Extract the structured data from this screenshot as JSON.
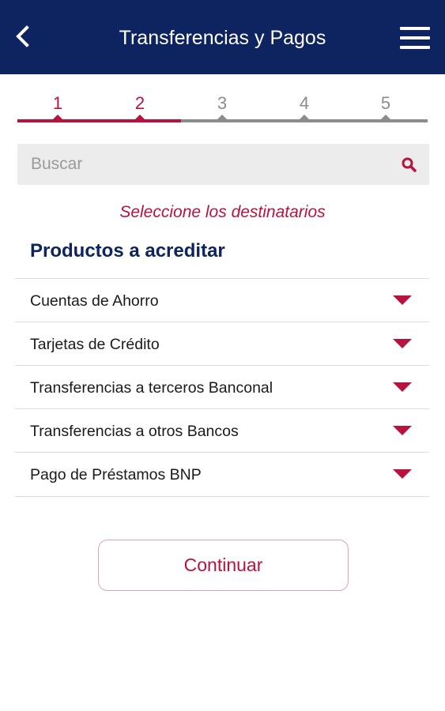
{
  "header": {
    "title": "Transferencias y Pagos",
    "back_icon": "chevron-left-icon",
    "menu_icon": "hamburger-menu-icon",
    "background_color": "#0e2461"
  },
  "stepper": {
    "current_step": 2,
    "total_steps": 5,
    "steps": [
      "1",
      "2",
      "3",
      "4",
      "5"
    ],
    "active_color": "#b8123e",
    "inactive_color": "#8c8c8c"
  },
  "search": {
    "placeholder": "Buscar",
    "value": "",
    "icon": "search-icon"
  },
  "instruction": "Seleccione los destinatarios",
  "section": {
    "title": "Productos a acreditar",
    "items": [
      {
        "label": "Cuentas de Ahorro",
        "icon": "chevron-down-icon"
      },
      {
        "label": "Tarjetas de Crédito",
        "icon": "chevron-down-icon"
      },
      {
        "label": "Transferencias a terceros Banconal",
        "icon": "chevron-down-icon"
      },
      {
        "label": "Transferencias a otros Bancos",
        "icon": "chevron-down-icon"
      },
      {
        "label": "Pago de Préstamos BNP",
        "icon": "chevron-down-icon"
      }
    ]
  },
  "continue_label": "Continuar",
  "accent_color": "#b8123e"
}
